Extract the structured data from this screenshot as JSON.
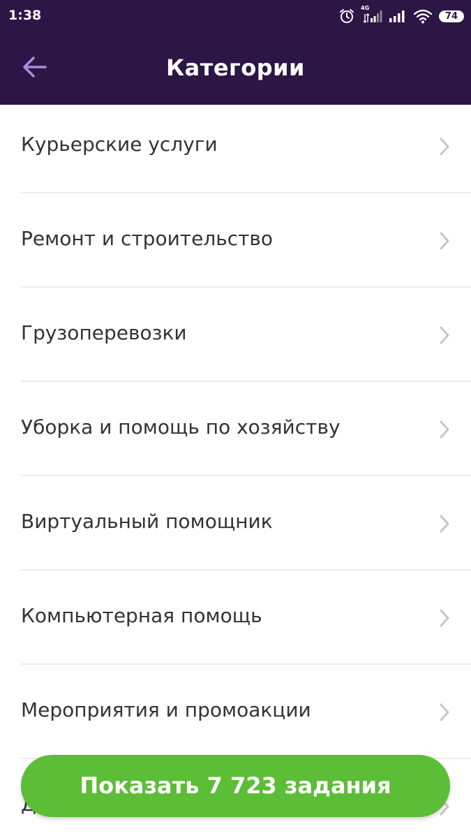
{
  "status_bar": {
    "time": "1:38",
    "network_type": "4G",
    "battery_level": "74",
    "icons": [
      "alarm-icon",
      "signal-4g-icon",
      "signal-icon",
      "wifi-icon",
      "battery-icon"
    ]
  },
  "header": {
    "title": "Категории",
    "back_icon": "arrow-left-icon"
  },
  "categories": [
    {
      "label": "Курьерские услуги"
    },
    {
      "label": "Ремонт и строительство"
    },
    {
      "label": "Грузоперевозки"
    },
    {
      "label": "Уборка и помощь по хозяйству"
    },
    {
      "label": "Виртуальный помощник"
    },
    {
      "label": "Компьютерная помощь"
    },
    {
      "label": "Мероприятия и промоакции"
    },
    {
      "label": "Д"
    }
  ],
  "show_button": {
    "label": "Показать 7 723 задания"
  },
  "colors": {
    "header_bg": "#2c1645",
    "back_arrow": "#a78be0",
    "chevron": "#c6c6c6",
    "button_bg": "#5cbd36",
    "item_text": "#333333"
  }
}
